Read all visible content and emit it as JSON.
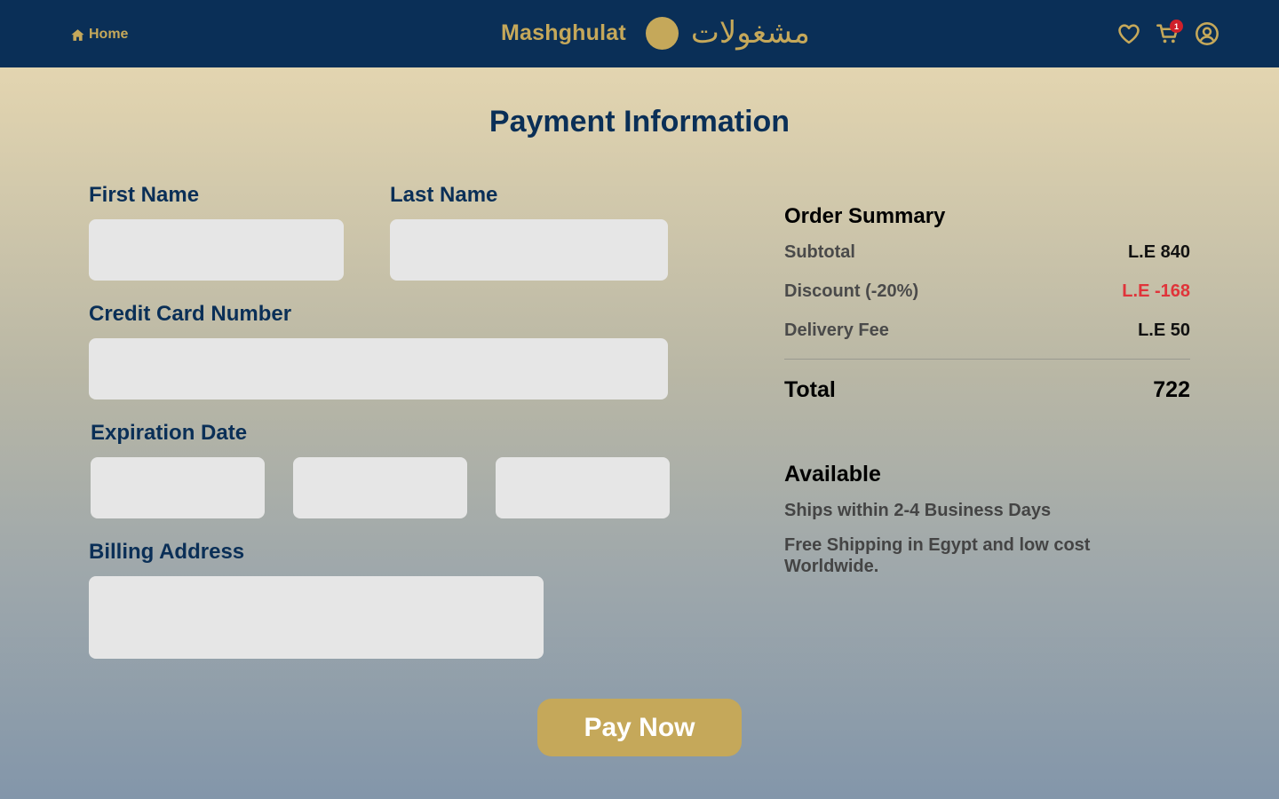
{
  "nav": {
    "home_label": "Home",
    "home_icon": "home-icon",
    "brand_latin": "Mashghulat",
    "brand_arabic": "مشغولات",
    "cart_count": "1",
    "icons": [
      "heart-icon",
      "cart-icon",
      "user-icon"
    ]
  },
  "page": {
    "title": "Payment Information"
  },
  "form": {
    "first_name_label": "First Name",
    "last_name_label": "Last Name",
    "card_number_label": "Credit Card Number",
    "expiration_label": "Expiration Date",
    "billing_label": "Billing Address",
    "first_name_value": "",
    "last_name_value": "",
    "card_number_value": "",
    "exp_1_value": "",
    "exp_2_value": "",
    "exp_3_value": "",
    "billing_value": ""
  },
  "summary": {
    "title": "Order Summary",
    "rows": [
      {
        "label": "Subtotal",
        "value": "L.E 840"
      },
      {
        "label": "Discount (-20%)",
        "value": "L.E -168"
      },
      {
        "label": "Delivery Fee",
        "value": "L.E 50"
      }
    ],
    "total_label": "Total",
    "total_value": "722"
  },
  "availability": {
    "title": "Available",
    "shipping_time": "Ships within 2-4 Business Days",
    "shipping_info": "Free Shipping in Egypt and low cost Worldwide."
  },
  "actions": {
    "pay_label": "Pay Now"
  },
  "colors": {
    "navy": "#0a2f57",
    "gold": "#c5a85a",
    "discount_red": "#e0343a",
    "badge_red": "#d0202a"
  }
}
